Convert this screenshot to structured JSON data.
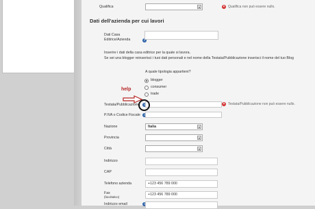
{
  "qualifica": {
    "label": "Qualifica",
    "error": "Qualifica non può essere nullo."
  },
  "section_title": "Dati dell'azienda per cui lavori",
  "dati_casa": {
    "label_line1": "Dati Casa",
    "label_line2": "Editrice/Azienda"
  },
  "info_text": {
    "line1": "Inserire i dati della casa editrice per la quale si lavora.",
    "line2": "Se sei una blogger reinserisci i tuoi dati personali e nel nome della Testata/Pubblicazione inserisci il nome del tuo Blog"
  },
  "tipologia": {
    "question": "A quale tipologia appartieni?",
    "options": [
      {
        "label": "blogger",
        "checked": true
      },
      {
        "label": "consumer",
        "checked": false
      },
      {
        "label": "trade",
        "checked": false
      }
    ]
  },
  "help_annotation": {
    "text": "help"
  },
  "testata": {
    "label": "Testata/Pubblicazione",
    "error": "Testata/Pubblicazione non può essere nullo."
  },
  "piva": {
    "label": "P.IVA o Codice Fiscale"
  },
  "nazione": {
    "label": "Nazione",
    "value": "Italia"
  },
  "provincia": {
    "label": "Provincia",
    "value": ""
  },
  "citta": {
    "label": "Città",
    "value": ""
  },
  "indirizzo": {
    "label": "Indirizzo"
  },
  "cap": {
    "label": "CAP"
  },
  "telefono": {
    "label": "Telefono azienda",
    "value": "+123 456 789 000"
  },
  "fax": {
    "label_line1": "Fax",
    "label_line2": "(facoltativo)",
    "value": "+123 456 789 000"
  },
  "partial_field": {
    "label": "Indirizzo email",
    "value": ""
  },
  "colors": {
    "error_red": "#d32f2f",
    "info_blue": "#2f63a8",
    "help_red": "#b52424"
  }
}
